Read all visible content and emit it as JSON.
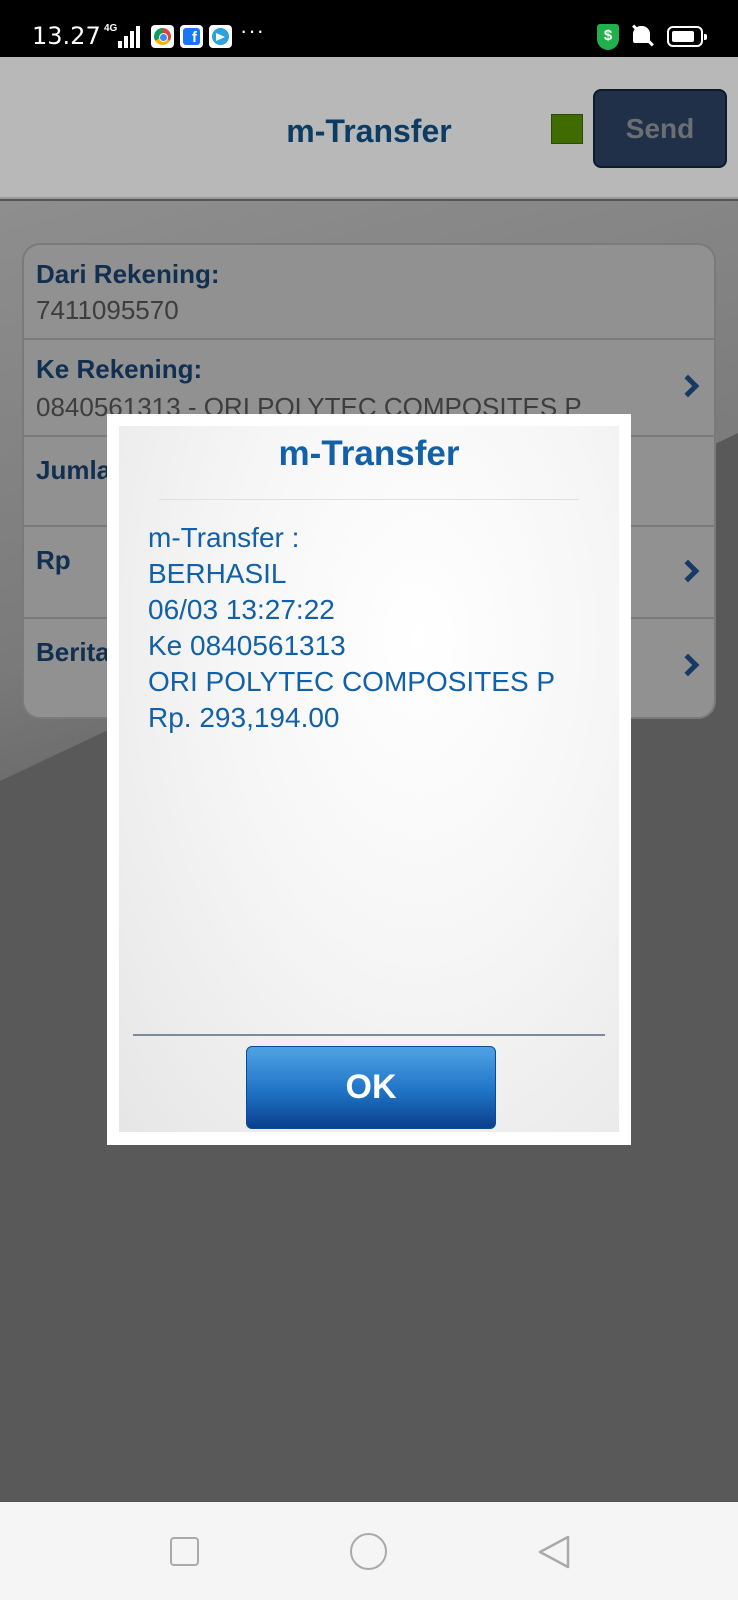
{
  "status_bar": {
    "time": "13.27",
    "network": "4G",
    "more": "···"
  },
  "header": {
    "title": "m-Transfer",
    "send_label": "Send",
    "indicator_color": "#3f6b00"
  },
  "form": {
    "rows": [
      {
        "label": "Dari Rekening:",
        "value": "7411095570"
      },
      {
        "label": "Ke Rekening:",
        "value": "0840561313 - ORI POLYTEC COMPOSITES P"
      },
      {
        "label": "Jumla",
        "value": ""
      },
      {
        "label": "Rp",
        "value": ""
      },
      {
        "label": "Berita",
        "value": ""
      }
    ]
  },
  "dialog": {
    "title": "m-Transfer",
    "lines": [
      "m-Transfer :",
      "BERHASIL",
      "06/03 13:27:22",
      "Ke 0840561313",
      "ORI POLYTEC COMPOSITES P",
      "Rp. 293,194.00"
    ],
    "ok_label": "OK"
  },
  "colors": {
    "accent": "#1260a8",
    "header_title": "#0c3b63",
    "button_dark": "#1f3048"
  },
  "icons": [
    "shield-icon",
    "mute-icon",
    "battery-icon",
    "chevron-right-icon",
    "home-circle-icon",
    "recents-square-icon",
    "back-triangle-icon"
  ]
}
